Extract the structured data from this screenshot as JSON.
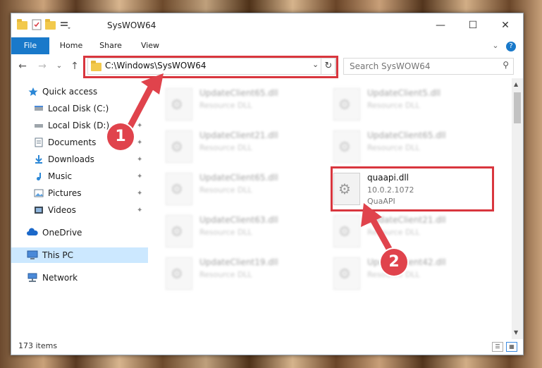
{
  "window": {
    "title": "SysWOW64",
    "minimize_glyph": "—",
    "maximize_glyph": "☐",
    "close_glyph": "✕"
  },
  "ribbon": {
    "tabs": [
      {
        "label": "File"
      },
      {
        "label": "Home"
      },
      {
        "label": "Share"
      },
      {
        "label": "View"
      }
    ],
    "collapse_glyph": "⌄",
    "help_glyph": "?"
  },
  "nav": {
    "back_glyph": "←",
    "forward_glyph": "→",
    "recent_glyph": "⌄",
    "up_glyph": "↑",
    "address": "C:\\Windows\\SysWOW64",
    "address_dropdown_glyph": "⌄",
    "refresh_glyph": "↻",
    "search_placeholder": "Search SysWOW64",
    "search_glyph": "⚲"
  },
  "sidebar": {
    "items": [
      {
        "label": "Quick access",
        "icon": "star-icon"
      },
      {
        "label": "Local Disk (C:)",
        "icon": "drive-icon"
      },
      {
        "label": "Local Disk (D:)",
        "icon": "drive-icon"
      },
      {
        "label": "Documents",
        "icon": "documents-icon"
      },
      {
        "label": "Downloads",
        "icon": "downloads-icon"
      },
      {
        "label": "Music",
        "icon": "music-icon"
      },
      {
        "label": "Pictures",
        "icon": "pictures-icon"
      },
      {
        "label": "Videos",
        "icon": "videos-icon"
      },
      {
        "label": "OneDrive",
        "icon": "cloud-icon"
      },
      {
        "label": "This PC",
        "icon": "computer-icon"
      },
      {
        "label": "Network",
        "icon": "network-icon"
      }
    ],
    "pin_glyph": "📌"
  },
  "files": [
    {
      "name": "UpdateClient65.dll",
      "sub": "Resource DLL"
    },
    {
      "name": "UpdateClient5.dll",
      "sub": "Resource DLL"
    },
    {
      "name": "UpdateClient21.dll",
      "sub": "Resource DLL"
    },
    {
      "name": "UpdateClient65.dll",
      "sub": "Resource DLL"
    },
    {
      "name": "UpdateClient65.dll",
      "sub": "Resource DLL"
    },
    {
      "name": "quaapi.dll",
      "sub": "10.0.2.1072",
      "sub2": "QuaAPI"
    },
    {
      "name": "UpdateClient63.dll",
      "sub": "Resource DLL"
    },
    {
      "name": "UpdateClient21.dll",
      "sub": "Resource DLL"
    },
    {
      "name": "UpdateClient19.dll",
      "sub": "Resource DLL"
    },
    {
      "name": "UpdateClient42.dll",
      "sub": "Resource DLL"
    }
  ],
  "status": {
    "item_count": "173 items"
  },
  "markers": [
    {
      "label": "1"
    },
    {
      "label": "2"
    }
  ],
  "colors": {
    "accent": "#1979ca",
    "highlight": "#d9363e",
    "selection": "#cce8ff"
  }
}
